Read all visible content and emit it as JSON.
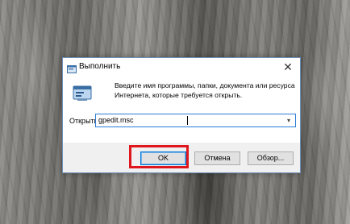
{
  "dialog": {
    "title": "Выполнить",
    "close_glyph": "✕",
    "description": "Введите имя программы, папки, документа или ресурса Интернета, которые требуется открыть.",
    "open_label": "Открыть:",
    "input_value": "gpedit.msc",
    "dropdown_arrow": "▾"
  },
  "buttons": {
    "ok": "OK",
    "cancel": "Отмена",
    "browse": "Обзор..."
  },
  "icons": {
    "title": "run-app-icon",
    "main": "run-dialog-icon",
    "close": "close-icon"
  },
  "colors": {
    "highlight": "#e0161d",
    "focus_border": "#0078d7"
  }
}
